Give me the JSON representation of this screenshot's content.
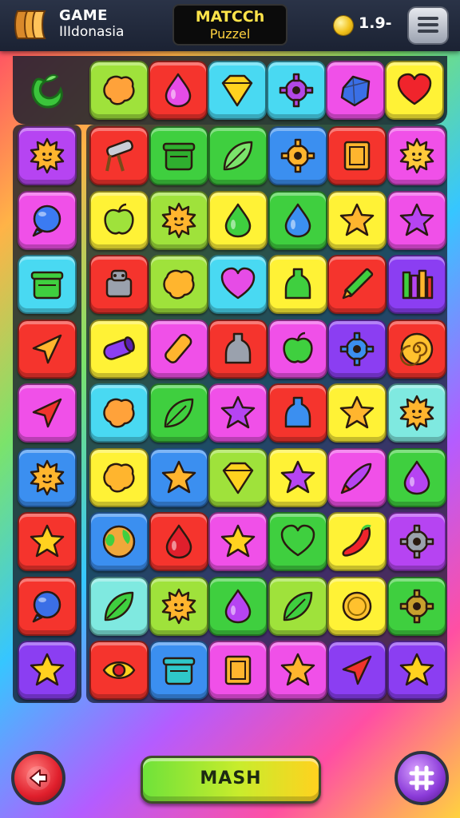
{
  "header": {
    "brand_line1": "GAME",
    "brand_line2": "IIIdonasia",
    "title_line1": "MATCCh",
    "title_line2": "Puzzel",
    "coins": "1.9-",
    "logo_icon": "wooden-scroll-logo",
    "coin_icon": "gold-coin-icon",
    "menu_icon": "menu-icon"
  },
  "footer": {
    "mash_label": "MASH",
    "back_icon": "back-arrow-icon",
    "grid_icon": "grid-icon"
  },
  "hint": {
    "icon": "leaf-swirl-icon",
    "color": "#3bc43b"
  },
  "colors": {
    "red": "#f5342d",
    "purple": "#b644f2",
    "lime": "#9fe23b",
    "yellow": "#fff236",
    "cyan": "#49d9f2",
    "blue": "#3b8ff0",
    "green": "#3fcf3f",
    "magenta": "#f050e8",
    "violet": "#8b3ef2",
    "orange": "#ffb52e",
    "mint": "#7fe9e0",
    "teal": "#2fc7c9"
  },
  "top_row": [
    {
      "bg": "lime",
      "icon": "blob-icon",
      "ic": "#ffa23a"
    },
    {
      "bg": "red",
      "icon": "drop-icon",
      "ic": "#e64ce6"
    },
    {
      "bg": "cyan",
      "icon": "diamond-icon",
      "ic": "#ffd21f"
    },
    {
      "bg": "cyan",
      "icon": "gear-icon",
      "ic": "#b247e6"
    },
    {
      "bg": "magenta",
      "icon": "crystal-icon",
      "ic": "#3a6fe6"
    },
    {
      "bg": "yellow",
      "icon": "heart-icon",
      "ic": "#f0242c"
    }
  ],
  "left_column": [
    {
      "bg": "purple",
      "icon": "sun-icon",
      "ic": "#ffb52e"
    },
    {
      "bg": "magenta",
      "icon": "orb-icon",
      "ic": "#3b7bf2"
    },
    {
      "bg": "cyan",
      "icon": "pot-icon",
      "ic": "#3fcf3f"
    },
    {
      "bg": "red",
      "icon": "arrow-icon",
      "ic": "#ffb52e"
    },
    {
      "bg": "magenta",
      "icon": "arrow-icon",
      "ic": "#f0342d"
    },
    {
      "bg": "blue",
      "icon": "sun-icon",
      "ic": "#ffb52e"
    },
    {
      "bg": "red",
      "icon": "star-icon",
      "ic": "#ffd21f"
    },
    {
      "bg": "red",
      "icon": "orb-icon",
      "ic": "#3b6fe6"
    },
    {
      "bg": "violet",
      "icon": "star-icon",
      "ic": "#ffd21f"
    }
  ],
  "grid": [
    [
      {
        "bg": "red",
        "icon": "cannon-icon",
        "ic": "#c9cdd6"
      },
      {
        "bg": "green",
        "icon": "pot-icon",
        "ic": "#2fae2f"
      },
      {
        "bg": "green",
        "icon": "leaf-icon",
        "ic": "#7be36b"
      },
      {
        "bg": "blue",
        "icon": "gear-icon",
        "ic": "#ffb52e"
      },
      {
        "bg": "red",
        "icon": "box-icon",
        "ic": "#ffb52e"
      },
      {
        "bg": "magenta",
        "icon": "sun-icon",
        "ic": "#ffc93a"
      }
    ],
    [
      {
        "bg": "yellow",
        "icon": "apple-icon",
        "ic": "#9fe23b"
      },
      {
        "bg": "lime",
        "icon": "sun-icon",
        "ic": "#ffb52e"
      },
      {
        "bg": "yellow",
        "icon": "drop-icon",
        "ic": "#3fcf3f"
      },
      {
        "bg": "green",
        "icon": "drop-icon",
        "ic": "#3b8ff0"
      },
      {
        "bg": "yellow",
        "icon": "star-icon",
        "ic": "#ffb52e"
      },
      {
        "bg": "magenta",
        "icon": "star-icon",
        "ic": "#b644f2"
      }
    ],
    [
      {
        "bg": "red",
        "icon": "robot-icon",
        "ic": "#9aa1ad"
      },
      {
        "bg": "lime",
        "icon": "blob-icon",
        "ic": "#ffb52e"
      },
      {
        "bg": "cyan",
        "icon": "heart-icon",
        "ic": "#e64ce6"
      },
      {
        "bg": "yellow",
        "icon": "bottle-icon",
        "ic": "#3fcf3f"
      },
      {
        "bg": "red",
        "icon": "pencil-icon",
        "ic": "#3fcf3f"
      },
      {
        "bg": "violet",
        "icon": "bars-icon",
        "ic": "#ffb52e"
      }
    ],
    [
      {
        "bg": "yellow",
        "icon": "tube-icon",
        "ic": "#8b3ef2"
      },
      {
        "bg": "magenta",
        "icon": "candy-icon",
        "ic": "#ffb52e"
      },
      {
        "bg": "red",
        "icon": "bottle-icon",
        "ic": "#9aa1ad"
      },
      {
        "bg": "magenta",
        "icon": "apple-icon",
        "ic": "#3fcf3f"
      },
      {
        "bg": "violet",
        "icon": "gear-icon",
        "ic": "#3b8ff0"
      },
      {
        "bg": "red",
        "icon": "spiral-icon",
        "ic": "#ffc12e"
      }
    ],
    [
      {
        "bg": "cyan",
        "icon": "blob-icon",
        "ic": "#ffa23a"
      },
      {
        "bg": "green",
        "icon": "leaf-icon",
        "ic": "#3fcf3f"
      },
      {
        "bg": "magenta",
        "icon": "star-icon",
        "ic": "#b644f2"
      },
      {
        "bg": "red",
        "icon": "bottle-icon",
        "ic": "#3b8ff0"
      },
      {
        "bg": "yellow",
        "icon": "star-icon",
        "ic": "#ffb52e"
      },
      {
        "bg": "mint",
        "icon": "sun-icon",
        "ic": "#ffb52e"
      }
    ],
    [
      {
        "bg": "yellow",
        "icon": "blob-icon",
        "ic": "#ffb52e"
      },
      {
        "bg": "blue",
        "icon": "star-icon",
        "ic": "#ffb52e"
      },
      {
        "bg": "lime",
        "icon": "diamond-icon",
        "ic": "#ffd21f"
      },
      {
        "bg": "yellow",
        "icon": "star-icon",
        "ic": "#b644f2"
      },
      {
        "bg": "magenta",
        "icon": "rocket-icon",
        "ic": "#b644f2"
      },
      {
        "bg": "green",
        "icon": "drop-icon",
        "ic": "#b644f2"
      }
    ],
    [
      {
        "bg": "blue",
        "icon": "globe-icon",
        "ic": "#3fcf3f"
      },
      {
        "bg": "red",
        "icon": "drop-icon",
        "ic": "#e01f2c"
      },
      {
        "bg": "magenta",
        "icon": "star-icon",
        "ic": "#ffd21f"
      },
      {
        "bg": "green",
        "icon": "heart-icon",
        "ic": "#3fcf3f"
      },
      {
        "bg": "yellow",
        "icon": "pepper-icon",
        "ic": "#f0242c"
      },
      {
        "bg": "purple",
        "icon": "gear-icon",
        "ic": "#9aa1ad"
      }
    ],
    [
      {
        "bg": "mint",
        "icon": "leaf-icon",
        "ic": "#3fcf3f"
      },
      {
        "bg": "lime",
        "icon": "sun-icon",
        "ic": "#ffb52e"
      },
      {
        "bg": "green",
        "icon": "drop-icon",
        "ic": "#b644f2"
      },
      {
        "bg": "lime",
        "icon": "leaf-icon",
        "ic": "#3fcf3f"
      },
      {
        "bg": "yellow",
        "icon": "coin-icon",
        "ic": "#ffc12e"
      },
      {
        "bg": "green",
        "icon": "gear-icon",
        "ic": "#c9a02e"
      }
    ],
    [
      {
        "bg": "red",
        "icon": "eye-icon",
        "ic": "#ffd21f"
      },
      {
        "bg": "blue",
        "icon": "pot-icon",
        "ic": "#2fc7c9"
      },
      {
        "bg": "magenta",
        "icon": "box-icon",
        "ic": "#ffb52e"
      },
      {
        "bg": "magenta",
        "icon": "star-icon",
        "ic": "#ffb52e"
      },
      {
        "bg": "violet",
        "icon": "arrow-icon",
        "ic": "#f0342d"
      },
      {
        "bg": "violet",
        "icon": "star-icon",
        "ic": "#ffd21f"
      }
    ]
  ]
}
